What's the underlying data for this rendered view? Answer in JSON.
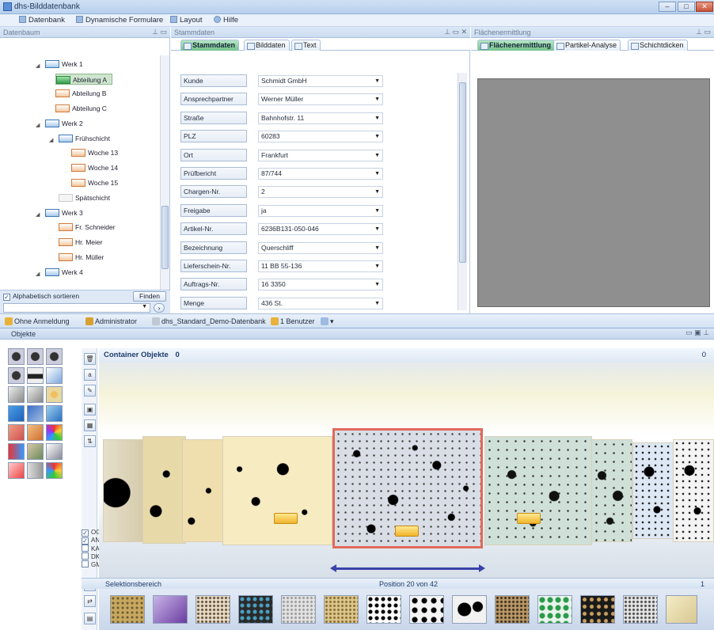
{
  "window": {
    "title": "dhs-Bilddatenbank"
  },
  "menu": [
    {
      "label": "Datenbank"
    },
    {
      "label": "Dynamische Formulare"
    },
    {
      "label": "Layout"
    },
    {
      "label": "Hilfe"
    }
  ],
  "tree_panel": {
    "title": "Datenbaum",
    "nodes": [
      {
        "label": "Werk 1"
      },
      {
        "label": "Abteilung A"
      },
      {
        "label": "Abteilung B"
      },
      {
        "label": "Abteilung C"
      },
      {
        "label": "Werk 2"
      },
      {
        "label": "Frühschicht"
      },
      {
        "label": "Woche 13"
      },
      {
        "label": "Woche 14"
      },
      {
        "label": "Woche 15"
      },
      {
        "label": "Spätschicht"
      },
      {
        "label": "Werk 3"
      },
      {
        "label": "Fr. Schneider"
      },
      {
        "label": "Hr. Meier"
      },
      {
        "label": "Hr. Müller"
      },
      {
        "label": "Werk 4"
      }
    ],
    "sort_label": "Alphabetisch sortieren",
    "sort_checked": true,
    "find_button": "Finden"
  },
  "stammdaten_panel": {
    "title": "Stammdaten",
    "tabs": [
      {
        "label": "Stammdaten"
      },
      {
        "label": "Bilddaten"
      },
      {
        "label": "Text"
      }
    ],
    "fields": [
      {
        "label": "Kunde",
        "value": "Schmidt GmbH"
      },
      {
        "label": "Ansprechpartner",
        "value": "Werner Müller"
      },
      {
        "label": "Straße",
        "value": "Bahnhofstr. 11"
      },
      {
        "label": "PLZ",
        "value": "60283"
      },
      {
        "label": "Ort",
        "value": "Frankfurt"
      },
      {
        "label": "Prüfbericht",
        "value": "87/744"
      },
      {
        "label": "Chargen-Nr.",
        "value": "2"
      },
      {
        "label": "Freigabe",
        "value": "ja"
      },
      {
        "label": "Artikel-Nr.",
        "value": "6236B131-050-046"
      },
      {
        "label": "Bezeichnung",
        "value": "Querschliff"
      },
      {
        "label": "Lieferschein-Nr.",
        "value": "11 BB 55-136"
      },
      {
        "label": "Auftrags-Nr.",
        "value": "16 3350"
      },
      {
        "label": "Menge",
        "value": "436 St."
      }
    ]
  },
  "flaechen_panel": {
    "title": "Flächenermittlung",
    "tabs": [
      {
        "label": "Flächenermittlung"
      },
      {
        "label": "Partikel-Analyse"
      },
      {
        "label": "Schichtdicken"
      }
    ]
  },
  "statusbar": [
    {
      "label": "Ohne Anmeldung"
    },
    {
      "label": "Administrator"
    },
    {
      "label": "dhs_Standard_Demo-Datenbank"
    },
    {
      "label": "1 Benutzer"
    }
  ],
  "objekte": {
    "title": "Objekte",
    "container_label": "Container Objekte",
    "container_count": "0",
    "container_right": "0",
    "checks": [
      {
        "label": "OG",
        "checked": true
      },
      {
        "label": "AN",
        "checked": true
      },
      {
        "label": "KA",
        "checked": false
      },
      {
        "label": "DK",
        "checked": false
      },
      {
        "label": "GM",
        "checked": false
      }
    ],
    "selection_label": "Selektionsbereich",
    "position_text": "Position 20 von 42",
    "selection_right": "1"
  },
  "colors": {
    "accent": "#e06a5a",
    "arrow": "#3a42a8",
    "active_tab": "#74c28c"
  }
}
